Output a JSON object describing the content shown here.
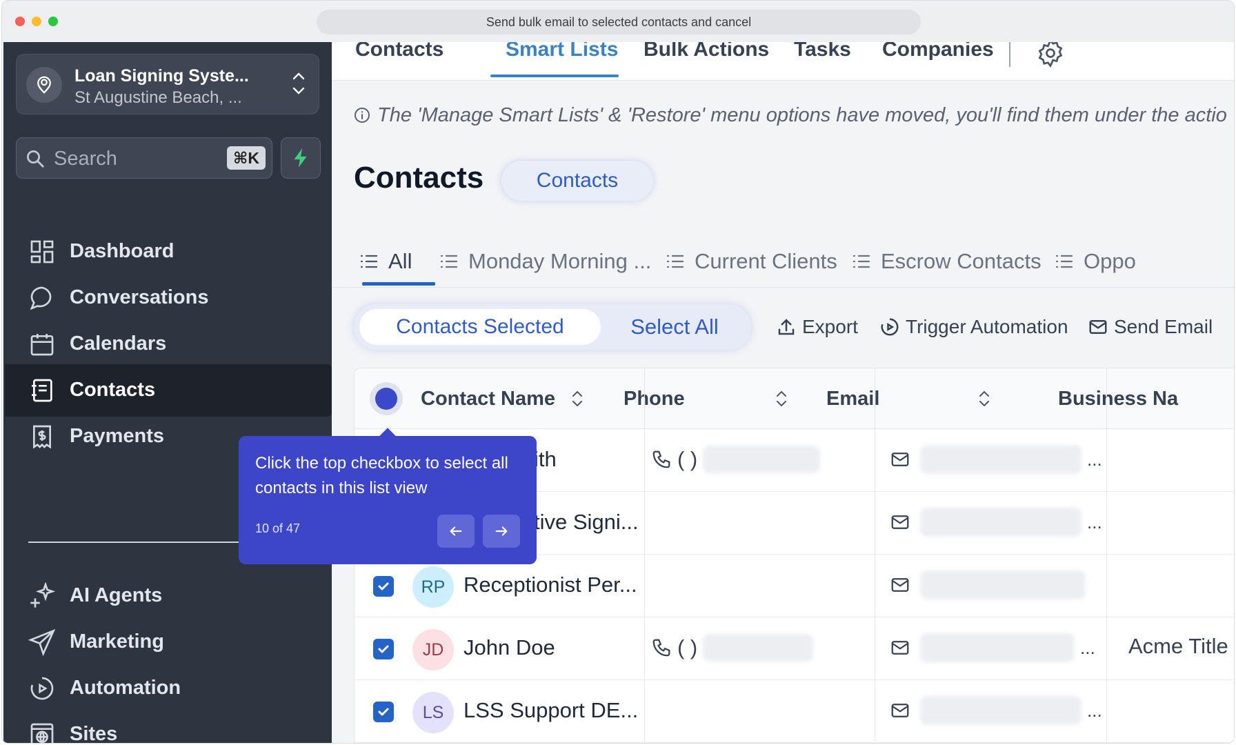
{
  "browser": {
    "url_bar_text": "Send bulk email to selected contacts and cancel"
  },
  "sidebar": {
    "location": {
      "name": "Loan Signing Syste...",
      "address": "St Augustine Beach, ..."
    },
    "search": {
      "placeholder": "Search",
      "shortcut": "⌘K"
    },
    "nav_items": [
      {
        "label": "Dashboard",
        "icon": "dashboard-icon",
        "active": false
      },
      {
        "label": "Conversations",
        "icon": "chat-bubble-icon",
        "active": false
      },
      {
        "label": "Calendars",
        "icon": "calendar-icon",
        "active": false
      },
      {
        "label": "Contacts",
        "icon": "contacts-book-icon",
        "active": true
      },
      {
        "label": "Payments",
        "icon": "payments-icon",
        "active": false
      },
      {
        "label": "AI Agents",
        "icon": "sparkle-icon",
        "active": false
      },
      {
        "label": "Marketing",
        "icon": "paper-plane-icon",
        "active": false
      },
      {
        "label": "Automation",
        "icon": "automation-icon",
        "active": false
      },
      {
        "label": "Sites",
        "icon": "globe-window-icon",
        "active": false
      }
    ]
  },
  "topnav": {
    "tabs": [
      "Contacts",
      "Smart Lists",
      "Bulk Actions",
      "Tasks",
      "Companies"
    ],
    "active": "Smart Lists"
  },
  "notice": {
    "text": "The 'Manage Smart Lists' & 'Restore' menu options have moved, you'll find them under the actio"
  },
  "page": {
    "title": "Contacts",
    "pill_label": "Contacts"
  },
  "smart_lists": {
    "tabs": [
      "All",
      "Monday Morning ...",
      "Current Clients",
      "Escrow Contacts",
      "Oppo"
    ],
    "active": "All"
  },
  "actions": {
    "contacts_selected": "Contacts Selected",
    "select_all": "Select All",
    "export": "Export",
    "trigger_automation": "Trigger Automation",
    "send_email": "Send Email"
  },
  "table": {
    "columns": [
      "Contact Name",
      "Phone",
      "Email",
      "Business Na"
    ],
    "rows": [
      {
        "initials": "",
        "name": "ith",
        "phone": "(      )",
        "has_phone": true,
        "email_ellipsis": "...",
        "business": "",
        "checked": true
      },
      {
        "initials": "",
        "name": "tive Signi...",
        "phone": "",
        "has_phone": false,
        "email_ellipsis": "...",
        "business": "",
        "checked": true
      },
      {
        "initials": "RP",
        "name": "Receptionist Per...",
        "phone": "",
        "has_phone": false,
        "email_ellipsis": "",
        "business": "",
        "checked": true
      },
      {
        "initials": "JD",
        "name": "John Doe",
        "phone": "(      )",
        "has_phone": true,
        "email_ellipsis": "...",
        "business": "Acme Title",
        "checked": true
      },
      {
        "initials": "LS",
        "name": "LSS Support DE...",
        "phone": "",
        "has_phone": false,
        "email_ellipsis": "...",
        "business": "",
        "checked": true
      }
    ]
  },
  "tooltip": {
    "text": "Click the top checkbox to select all contacts in this list view",
    "step": "10 of 47"
  },
  "colors": {
    "sidebar_bg": "#2e3440",
    "accent_blue": "#2563c9",
    "tooltip_bg": "#3d46c8",
    "avatar_rp": "#cdeefc",
    "avatar_jd": "#fde0e4",
    "avatar_ls": "#e4e1fb"
  }
}
